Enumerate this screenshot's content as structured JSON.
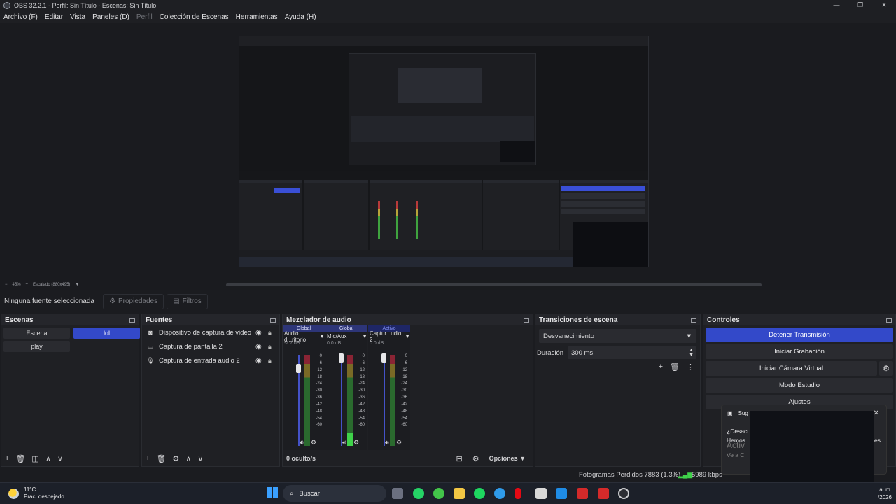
{
  "window": {
    "title": "OBS 32.2.1 - Perfil: Sin Título - Escenas: Sin Título",
    "controls": [
      "—",
      "❐",
      "✕"
    ]
  },
  "menu": [
    {
      "label": "Archivo (F)",
      "disabled": false
    },
    {
      "label": "Editar",
      "disabled": false
    },
    {
      "label": "Vista",
      "disabled": false
    },
    {
      "label": "Paneles (D)",
      "disabled": false
    },
    {
      "label": "Perfil",
      "disabled": true
    },
    {
      "label": "Colección de Escenas",
      "disabled": false
    },
    {
      "label": "Herramientas",
      "disabled": false
    },
    {
      "label": "Ayuda (H)",
      "disabled": false
    }
  ],
  "zoom": {
    "minus": "−",
    "level": "45%",
    "plus": "+",
    "scale_label": "Escalado (880x495)"
  },
  "context": {
    "no_source": "Ninguna fuente seleccionada",
    "properties": "Propiedades",
    "filters": "Filtros"
  },
  "scenes": {
    "title": "Escenas",
    "items": [
      {
        "label": "Escena",
        "selected": false
      },
      {
        "label": "lol",
        "selected": true
      },
      {
        "label": "play",
        "selected": false
      }
    ]
  },
  "sources": {
    "title": "Fuentes",
    "items": [
      {
        "label": "Dispositivo de captura de video",
        "icon": "camera-icon"
      },
      {
        "label": "Captura de pantalla 2",
        "icon": "monitor-icon"
      },
      {
        "label": "Captura de entrada audio 2",
        "icon": "microphone-icon"
      }
    ]
  },
  "mixer": {
    "title": "Mezclador de audio",
    "channels": [
      {
        "tag": "Global",
        "name": "Audio d...ritorio",
        "db": "-2.7 dB",
        "active": false,
        "level": 0.0
      },
      {
        "tag": "Global",
        "name": "Mic/Aux",
        "db": "0.0 dB",
        "active": false,
        "level": 0.14
      },
      {
        "tag": "Activo",
        "name": "Captur...udio 2",
        "db": "0.0 dB",
        "active": true,
        "level": 0.0
      }
    ],
    "scale": [
      "0",
      "-6",
      "-12",
      "-18",
      "-24",
      "-30",
      "-36",
      "-42",
      "-48",
      "-54",
      "-60"
    ],
    "hidden": "0 oculto/s",
    "options": "Opciones"
  },
  "transitions": {
    "title": "Transiciones de escena",
    "selected": "Desvanecimiento",
    "duration_label": "Duración",
    "duration_value": "300 ms"
  },
  "controls": {
    "title": "Controles",
    "stop_stream": "Detener Transmisión",
    "start_record": "Iniciar Grabación",
    "start_vcam": "Iniciar Cámara Virtual",
    "studio_mode": "Modo Estudio",
    "settings": "Ajustes"
  },
  "status": {
    "dropped": "Fotogramas Perdidos 7883 (1.3%)",
    "bitrate": "5989 kbps"
  },
  "toast": {
    "title": "Sug",
    "line1": "¿Desact",
    "line2": "Hemos",
    "line3": "Activ",
    "line4": "Ve a C",
    "suffix": "es."
  },
  "taskbar": {
    "temp": "11°C",
    "weather": "Prac. despejado",
    "search": "Buscar",
    "time": "a. m.",
    "date": "/2026"
  },
  "colors": {
    "accent": "#3349c9",
    "meter_green": "#3fd24a",
    "meter_red": "#8a2434"
  }
}
